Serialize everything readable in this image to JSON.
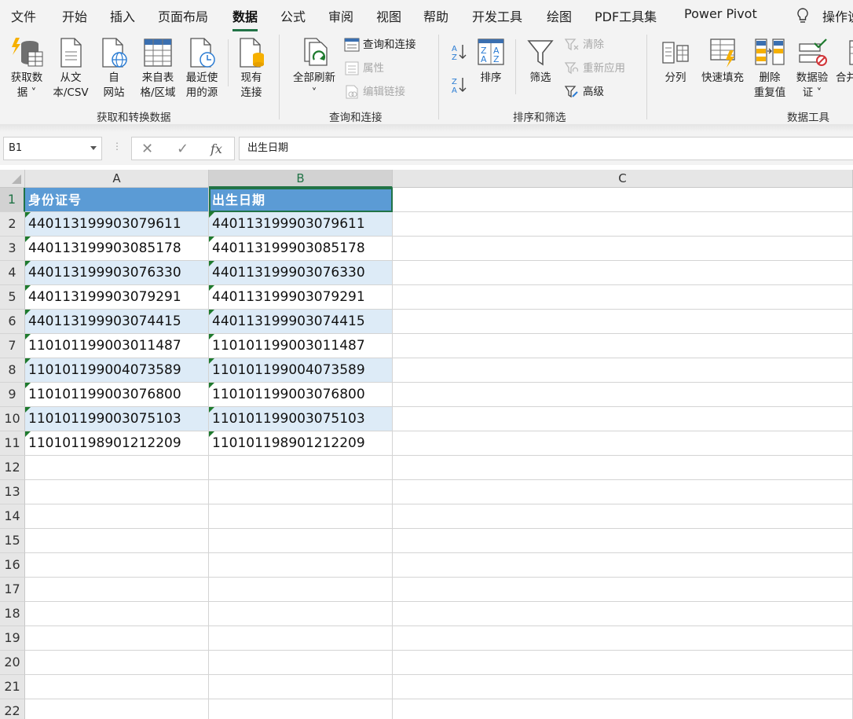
{
  "menu": {
    "tabs": [
      "文件",
      "开始",
      "插入",
      "页面布局",
      "数据",
      "公式",
      "审阅",
      "视图",
      "帮助",
      "开发工具",
      "绘图",
      "PDF工具集",
      "Power Pivot",
      "操作说"
    ],
    "active_index": 4
  },
  "ribbon": {
    "get_data": {
      "line1": "获取数",
      "line2": "据 ˅"
    },
    "from_csv": {
      "line1": "从文",
      "line2": "本/CSV"
    },
    "from_web": {
      "line1": "自",
      "line2": "网站"
    },
    "from_table": {
      "line1": "来自表",
      "line2": "格/区域"
    },
    "recent_sources": {
      "line1": "最近使",
      "line2": "用的源"
    },
    "existing_conn": {
      "line1": "现有",
      "line2": "连接"
    },
    "group1_label": "获取和转换数据",
    "refresh_all": {
      "line1": "全部刷新",
      "line2": "˅"
    },
    "queries_conn": "查询和连接",
    "properties": "属性",
    "edit_links": "编辑链接",
    "group2_label": "查询和连接",
    "sort": "排序",
    "filter": "筛选",
    "clear": "清除",
    "reapply": "重新应用",
    "advanced": "高级",
    "group3_label": "排序和筛选",
    "text_to_columns": "分列",
    "flash_fill": "快速填充",
    "remove_dup": {
      "line1": "删除",
      "line2": "重复值"
    },
    "data_validation": {
      "line1": "数据验",
      "line2": "证 ˅"
    },
    "consolidate": "合并",
    "group4_label": "数据工具"
  },
  "formula_bar": {
    "name_box": "B1",
    "dots": "⋮",
    "cancel": "✕",
    "enter": "✓",
    "fx": "fx",
    "content": "出生日期"
  },
  "sheet": {
    "columns": [
      "A",
      "B",
      "C"
    ],
    "rows": [
      "1",
      "2",
      "3",
      "4",
      "5",
      "6",
      "7",
      "8",
      "9",
      "10",
      "11",
      "12",
      "13",
      "14",
      "15",
      "16",
      "17",
      "18",
      "19",
      "20",
      "21",
      "22"
    ],
    "header": [
      "身份证号",
      "出生日期"
    ],
    "data": [
      [
        "440113199903079611",
        "440113199903079611"
      ],
      [
        "440113199903085178",
        "440113199903085178"
      ],
      [
        "440113199903076330",
        "440113199903076330"
      ],
      [
        "440113199903079291",
        "440113199903079291"
      ],
      [
        "440113199903074415",
        "440113199903074415"
      ],
      [
        "110101199003011487",
        "110101199003011487"
      ],
      [
        "110101199004073589",
        "110101199004073589"
      ],
      [
        "110101199003076800",
        "110101199003076800"
      ],
      [
        "110101199003075103",
        "110101199003075103"
      ],
      [
        "110101198901212209",
        "110101198901212209"
      ]
    ]
  }
}
